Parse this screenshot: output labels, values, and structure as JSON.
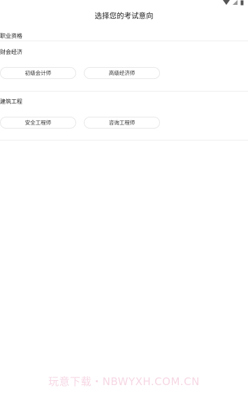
{
  "status_bar": {
    "icons": [
      "wifi-icon",
      "signal-icon",
      "battery-icon"
    ]
  },
  "header": {
    "title": "选择您的考试意向"
  },
  "section": {
    "title": "职业资格"
  },
  "groups": [
    {
      "title": "财会经济",
      "options": [
        "初级会计师",
        "高级经济师"
      ]
    },
    {
      "title": "建筑工程",
      "options": [
        "安全工程师",
        "咨询工程师"
      ]
    }
  ],
  "watermark": {
    "text": "玩意下载・NBWYXH.COM.CN"
  },
  "colors": {
    "divider": "#eeeeee",
    "chip_border": "#e8e8e8",
    "text": "#222222",
    "watermark": "#f6d7e4"
  }
}
